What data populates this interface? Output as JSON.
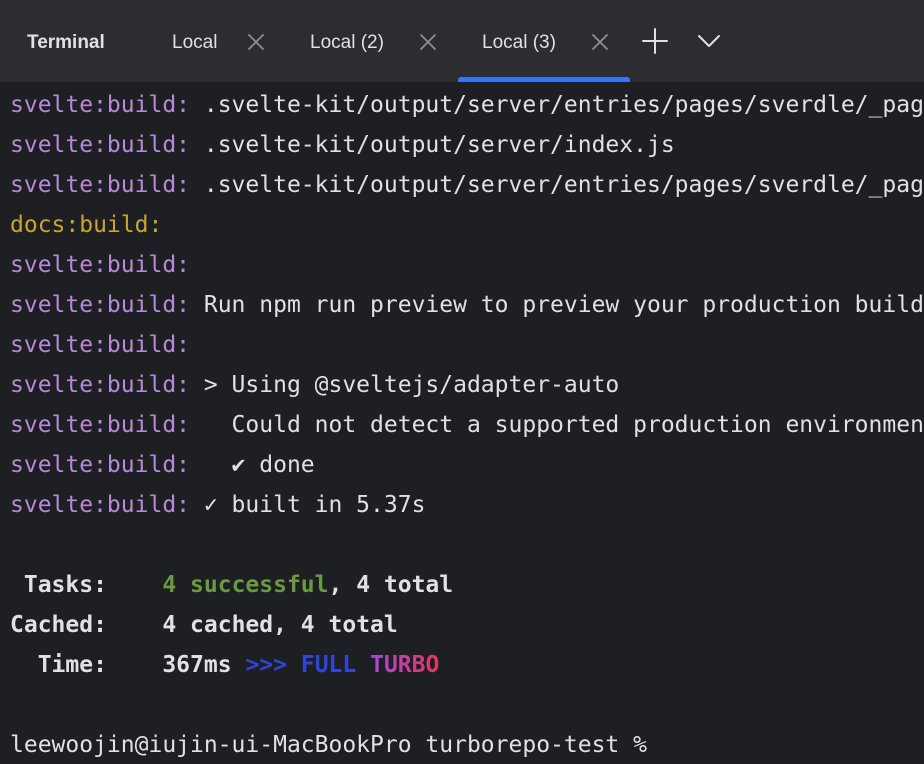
{
  "tool_window": {
    "title": "Terminal",
    "tabs": [
      {
        "label": "Local",
        "active": false
      },
      {
        "label": "Local (2)",
        "active": false
      },
      {
        "label": "Local (3)",
        "active": true
      }
    ],
    "accent_color": "#3574f0",
    "new_tab_icon": "plus-icon",
    "tab_list_icon": "chevron-down-icon"
  },
  "terminal": {
    "lines": [
      {
        "prefix": "svelte:build:",
        "text": " .svelte-kit/output/server/entries/pages/sverdle/_page.svelte.js"
      },
      {
        "prefix": "svelte:build:",
        "text": " .svelte-kit/output/server/index.js"
      },
      {
        "prefix": "svelte:build:",
        "text": " .svelte-kit/output/server/entries/pages/sverdle/_page.server.ts.js"
      },
      {
        "prefix": "docs:build:",
        "text": ""
      },
      {
        "prefix": "svelte:build:",
        "text": ""
      },
      {
        "prefix": "svelte:build:",
        "text": " Run npm run preview to preview your production build locally."
      },
      {
        "prefix": "svelte:build:",
        "text": ""
      },
      {
        "prefix": "svelte:build:",
        "text": " > Using @sveltejs/adapter-auto"
      },
      {
        "prefix": "svelte:build:",
        "text": "   Could not detect a supported production environment."
      },
      {
        "prefix": "svelte:build:",
        "text": "   ✔ done"
      },
      {
        "prefix": "svelte:build:",
        "text": " ✓ built in 5.37s"
      }
    ],
    "summary": {
      "tasks_label": " Tasks:",
      "tasks_successful": "4 successful",
      "tasks_total": ", 4 total",
      "cached_label": "Cached:",
      "cached_value": "4 cached, 4 total",
      "time_label": "  Time:",
      "time_value": "367ms",
      "turbo_arrows": ">>>",
      "turbo_full": "FULL",
      "turbo_word": "TURBO"
    },
    "prompt": "leewoojin@iujin-ui-MacBookPro turborepo-test %",
    "colors": {
      "svelte_prefix": "#b78ad9",
      "docs_prefix": "#c7a534",
      "success": "#6a9a3f",
      "turbo_blue": "#2f44d8",
      "turbo_gradient": [
        "#a24bd9",
        "#e0395d"
      ]
    }
  }
}
